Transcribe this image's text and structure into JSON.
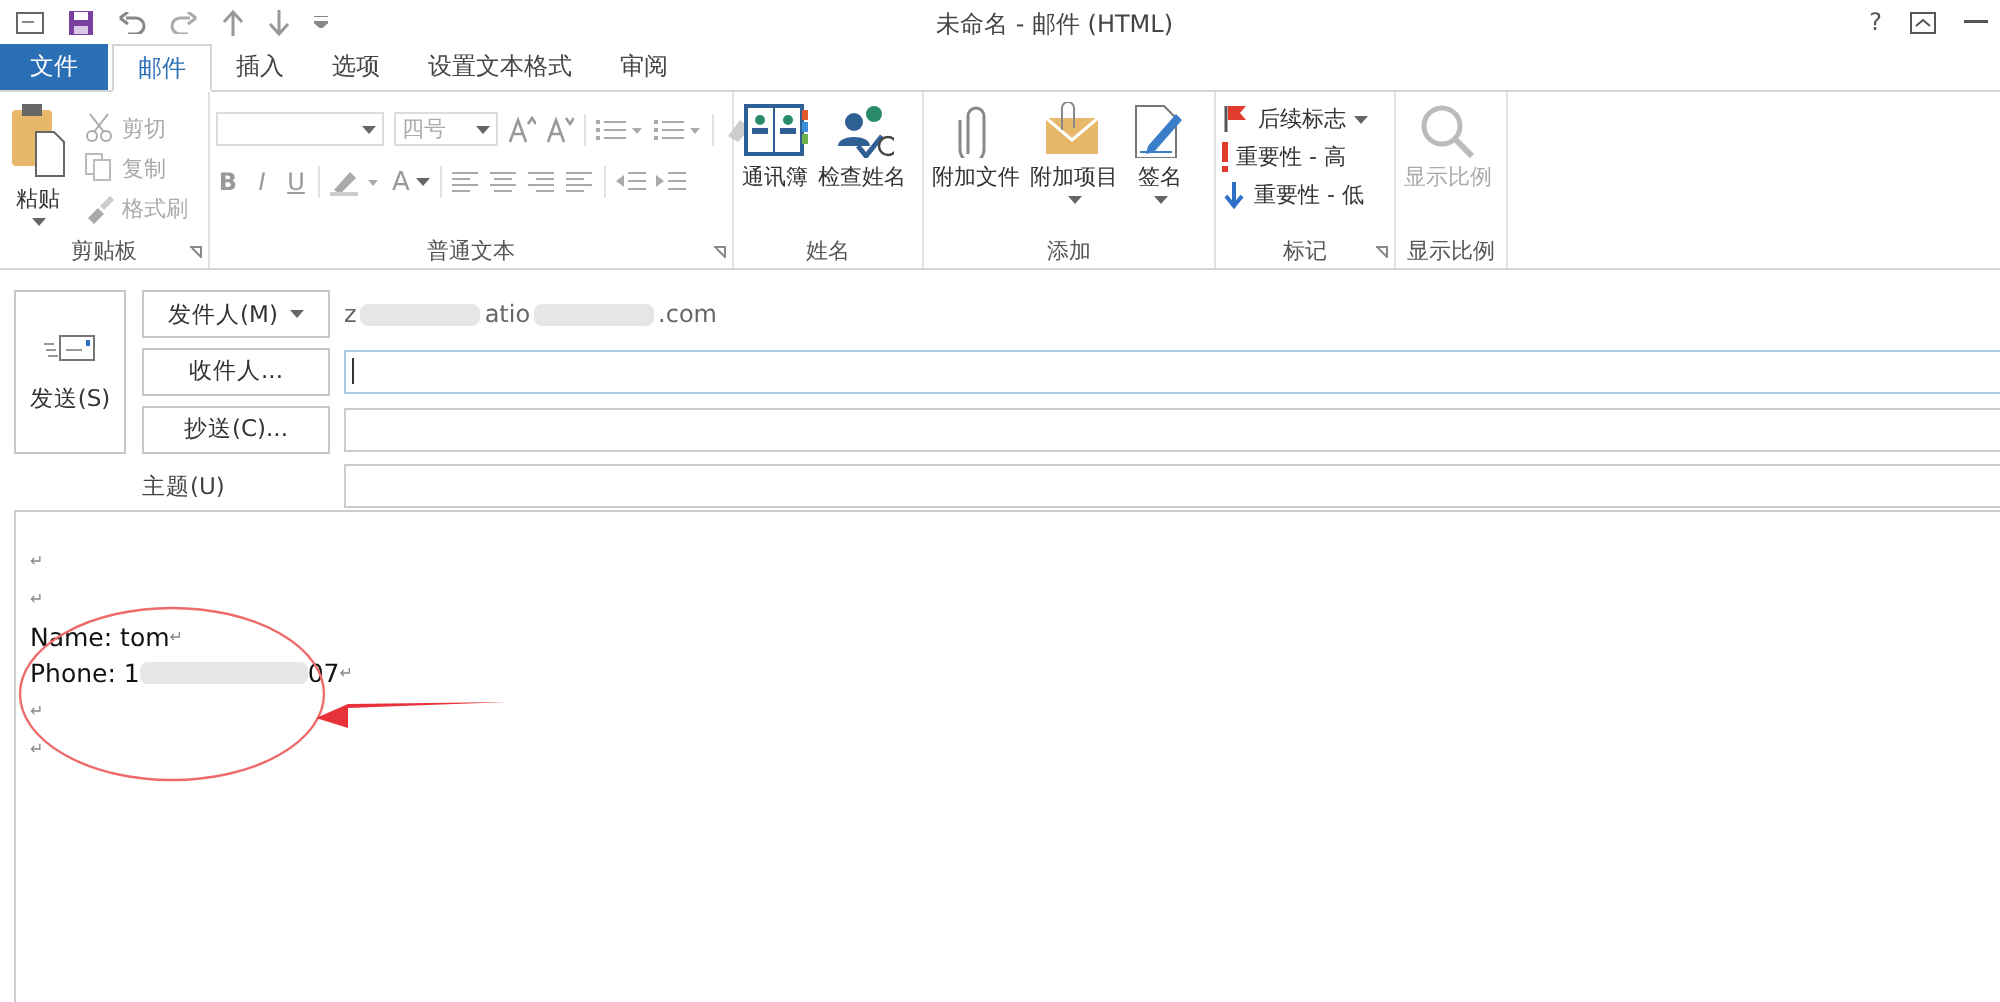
{
  "window": {
    "title": "未命名 - 邮件 (HTML)",
    "controls": [
      "?"
    ]
  },
  "tabs": [
    {
      "label": "文件",
      "kind": "file",
      "selected": false
    },
    {
      "label": "邮件",
      "kind": "tab",
      "selected": true
    },
    {
      "label": "插入",
      "kind": "tab",
      "selected": false
    },
    {
      "label": "选项",
      "kind": "tab",
      "selected": false
    },
    {
      "label": "设置文本格式",
      "kind": "tab",
      "selected": false
    },
    {
      "label": "审阅",
      "kind": "tab",
      "selected": false
    }
  ],
  "ribbon": {
    "clipboard": {
      "label": "剪贴板",
      "paste": "粘贴",
      "items": [
        {
          "label": "剪切",
          "disabled": true
        },
        {
          "label": "复制",
          "disabled": true
        },
        {
          "label": "格式刷",
          "disabled": true
        }
      ]
    },
    "text": {
      "label": "普通文本",
      "font_size": "四号",
      "format_buttons": [
        "B",
        "I",
        "U"
      ],
      "color_letter": "A"
    },
    "names": {
      "label": "姓名",
      "buttons": [
        {
          "label": "通讯簿"
        },
        {
          "label": "检查姓名"
        }
      ]
    },
    "add": {
      "label": "添加",
      "buttons": [
        {
          "label": "附加文件",
          "dropdown": false
        },
        {
          "label": "附加项目",
          "dropdown": true
        },
        {
          "label": "签名",
          "dropdown": true
        }
      ]
    },
    "tags": {
      "label": "标记",
      "items": [
        {
          "label": "后续标志",
          "dropdown": true
        },
        {
          "label": "重要性 - 高",
          "dropdown": false
        },
        {
          "label": "重要性 - 低",
          "dropdown": false
        }
      ]
    },
    "zoom": {
      "label": "显示比例",
      "button": "显示比例",
      "disabled": true
    }
  },
  "compose": {
    "send": "发送(S)",
    "from_button": "发件人(M)",
    "from_parts": [
      "z",
      "atio",
      ".com"
    ],
    "to_button": "收件人...",
    "cc_button": "抄送(C)...",
    "subject_label": "主题(U)"
  },
  "body": {
    "mark": "↵",
    "lines": [
      {
        "kind": "blank"
      },
      {
        "kind": "blank"
      },
      {
        "kind": "text",
        "parts": [
          {
            "text": "Name: tom"
          }
        ]
      },
      {
        "kind": "text",
        "parts": [
          {
            "text": "Phone: 1"
          },
          {
            "kind": "redacted"
          },
          {
            "text": "07"
          }
        ]
      },
      {
        "kind": "blank"
      },
      {
        "kind": "blank"
      }
    ]
  }
}
